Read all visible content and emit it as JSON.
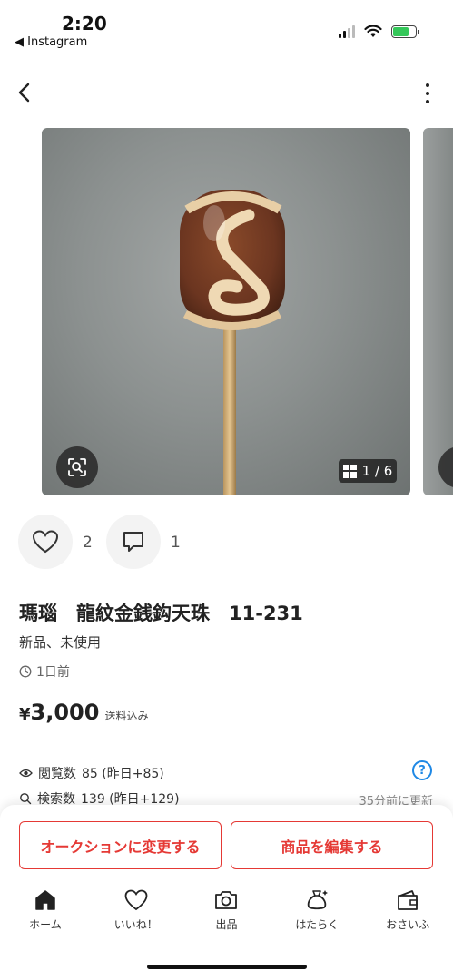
{
  "status_bar": {
    "time": "2:20",
    "back_app": "◀ Instagram"
  },
  "photo": {
    "counter": "1 / 6",
    "subject": "agate dzi bead on a pin"
  },
  "reactions": {
    "like_count": "2",
    "comment_count": "1"
  },
  "product": {
    "title": "瑪瑙　龍紋金銭鈎天珠　11-231",
    "condition": "新品、未使用",
    "posted": "1日前",
    "price_symbol": "¥",
    "price": "3,000",
    "shipping": "送料込み"
  },
  "stats": {
    "views_label": "閲覧数",
    "views_value": "85 (昨日+85)",
    "search_label": "検索数",
    "search_value": "139 (昨日+129)",
    "updated": "35分前に更新"
  },
  "actions": {
    "auction": "オークションに変更する",
    "edit": "商品を編集する"
  },
  "tabs": [
    {
      "label": "ホーム",
      "icon": "home-icon"
    },
    {
      "label": "いいね！",
      "icon": "heart-icon"
    },
    {
      "label": "出品",
      "icon": "camera-icon"
    },
    {
      "label": "はたらく",
      "icon": "money-bag-icon"
    },
    {
      "label": "おさいふ",
      "icon": "wallet-icon"
    }
  ],
  "colors": {
    "accent": "#e53935",
    "info": "#1e88e5"
  }
}
